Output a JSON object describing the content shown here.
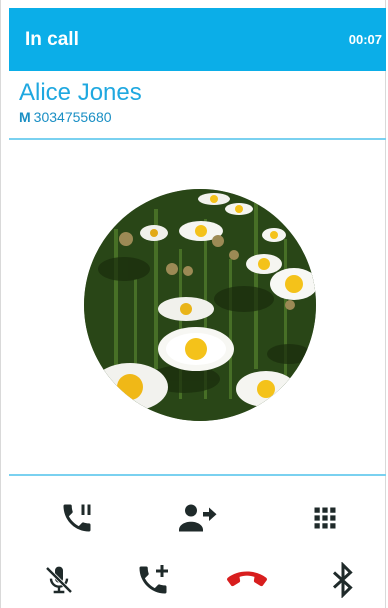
{
  "header": {
    "title": "In call",
    "elapsed": "00:07"
  },
  "caller": {
    "name": "Alice Jones",
    "number_type": "M",
    "number": "3034755680"
  },
  "controls": {
    "row1": [
      "hold-icon",
      "transfer-icon",
      "dialpad-icon"
    ],
    "row2": [
      "mute-icon",
      "add-call-icon",
      "end-call-icon",
      "bluetooth-icon"
    ]
  },
  "colors": {
    "accent": "#0baee8",
    "end_call": "#d81e1e",
    "icon": "#1f2a2a"
  }
}
